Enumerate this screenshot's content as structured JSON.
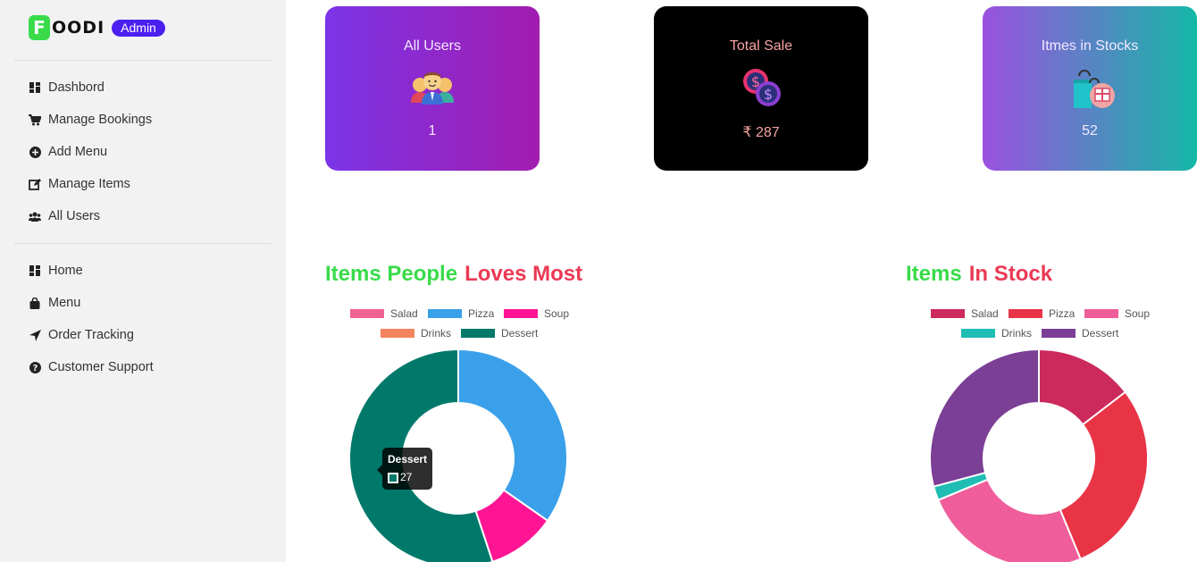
{
  "brand": {
    "logo_letter": "F",
    "logo_text": "OODI",
    "badge": "Admin"
  },
  "sidebar": {
    "admin_items": [
      {
        "label": "Dashbord",
        "icon": "dashboard-icon"
      },
      {
        "label": "Manage Bookings",
        "icon": "cart-icon"
      },
      {
        "label": "Add Menu",
        "icon": "plus-circle-icon"
      },
      {
        "label": "Manage Items",
        "icon": "edit-icon"
      },
      {
        "label": "All Users",
        "icon": "users-icon"
      }
    ],
    "site_items": [
      {
        "label": "Home",
        "icon": "dashboard-icon"
      },
      {
        "label": "Menu",
        "icon": "bag-icon"
      },
      {
        "label": "Order Tracking",
        "icon": "location-arrow-icon"
      },
      {
        "label": "Customer Support",
        "icon": "question-circle-icon"
      }
    ]
  },
  "stats": {
    "users": {
      "title": "All Users",
      "value": "1",
      "icon": "users-group-icon",
      "title_color": "#f3e8ff",
      "value_color": "#f3e8ff"
    },
    "sale": {
      "title": "Total Sale",
      "value": "₹ 287",
      "icon": "coins-icon",
      "title_color": "#f7a1a1",
      "value_color": "#f7a1a1"
    },
    "stock": {
      "title": "Itmes in Stocks",
      "value": "52",
      "icon": "shopping-bags-icon",
      "title_color": "#f3e8ff",
      "value_color": "#f3e8ff"
    }
  },
  "chart_loves": {
    "title_a": "Items People",
    "title_b": "Loves Most",
    "tooltip": {
      "label": "Dessert",
      "value": "27"
    }
  },
  "chart_stock": {
    "title_a": "Items",
    "title_b": "In Stock"
  },
  "chart_data": [
    {
      "type": "pie",
      "title": "Items People Loves Most",
      "categories": [
        "Salad",
        "Pizza",
        "Soup",
        "Drinks",
        "Dessert"
      ],
      "values": [
        0,
        17,
        5,
        0,
        27
      ],
      "colors": [
        "#f06292",
        "#3aa0ea",
        "#ff1493",
        "#f4845f",
        "#00796b"
      ],
      "legend": "top"
    },
    {
      "type": "pie",
      "title": "Items In Stock",
      "categories": [
        "Salad",
        "Pizza",
        "Soup",
        "Drinks",
        "Dessert"
      ],
      "values": [
        7,
        14,
        12,
        1,
        14
      ],
      "colors": [
        "#cc2a5c",
        "#e93446",
        "#ef5e9a",
        "#1fbdb4",
        "#7b3f96"
      ],
      "legend": "top"
    }
  ]
}
